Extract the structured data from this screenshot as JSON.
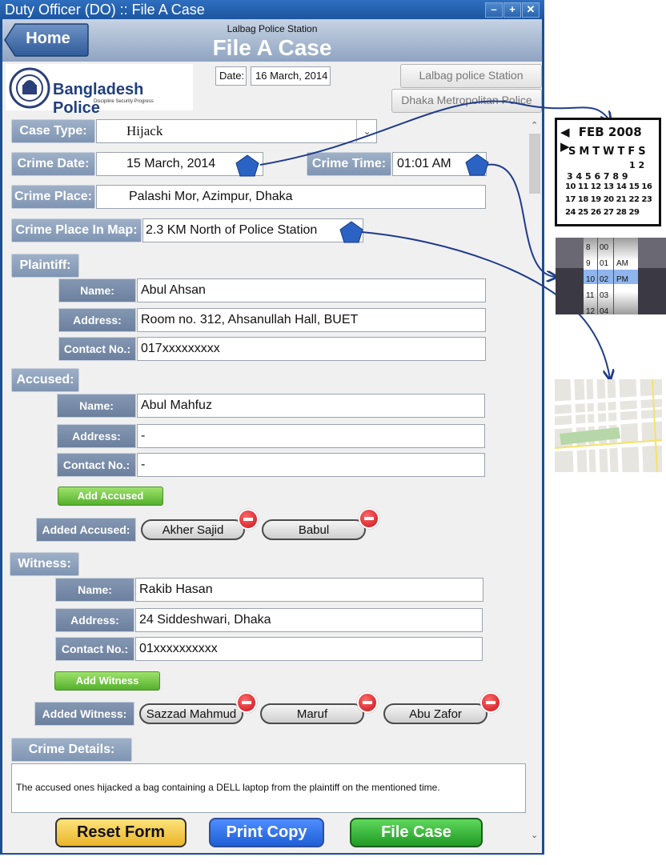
{
  "window": {
    "title": "Duty Officer (DO) :: File A Case",
    "buttons": [
      "minimize",
      "maximize",
      "close"
    ]
  },
  "header": {
    "home_label": "Home",
    "station": "Lalbag Police Station",
    "title": "File A Case"
  },
  "logo": {
    "name": "Bangladesh Police",
    "slogan": "Discipline Security Progress"
  },
  "date": {
    "label": "Date:",
    "value": "16 March, 2014"
  },
  "station_buttons": [
    "Lalbag police Station",
    "Dhaka Metropolitan Police"
  ],
  "case": {
    "case_type_label": "Case Type:",
    "case_type": "Hijack",
    "crime_date_label": "Crime Date:",
    "crime_date": "15 March, 2014",
    "crime_time_label": "Crime Time:",
    "crime_time": "01:01 AM",
    "crime_place_label": "Crime Place:",
    "crime_place": "Palashi Mor, Azimpur, Dhaka",
    "crime_map_label": "Crime Place In Map:",
    "crime_map": "2.3 KM North of Police Station"
  },
  "labels": {
    "name": "Name:",
    "address": "Address:",
    "contact": "Contact No.:"
  },
  "plaintiff": {
    "label": "Plaintiff:",
    "name": "Abul Ahsan",
    "address": "Room no. 312, Ahsanullah Hall, BUET",
    "contact": "017xxxxxxxxx"
  },
  "accused": {
    "label": "Accused:",
    "name": "Abul Mahfuz",
    "address": "-",
    "contact": "-",
    "add_button": "Add Accused",
    "added_label": "Added Accused:",
    "added": [
      "Akher Sajid",
      "Babul"
    ]
  },
  "witness": {
    "label": "Witness:",
    "name": "Rakib Hasan",
    "address": "24 Siddeshwari, Dhaka",
    "contact": "01xxxxxxxxxx",
    "add_button": "Add Witness",
    "added_label": "Added Witness:",
    "added": [
      "Sazzad Mahmud",
      "Maruf",
      "Abu Zafor"
    ]
  },
  "details": {
    "label": "Crime Details:",
    "text": "The accused ones hijacked a bag containing a DELL laptop from the plaintiff on the mentioned time."
  },
  "actions": {
    "reset": "Reset Form",
    "print": "Print Copy",
    "file": "File Case"
  },
  "calendar": {
    "month": "FEB 2008",
    "weekdays": "SMTWTFS",
    "rows": [
      "1 2",
      "3 4 5 6 7 8 9",
      "10 11 12 13 14 15 16",
      "17 18 19 20 21 22 23",
      "24 25 26 27 28 29"
    ]
  },
  "time_picker": {
    "hours": [
      "8",
      "9",
      "10",
      "11",
      "12"
    ],
    "minutes": [
      "00",
      "01",
      "02",
      "03",
      "04"
    ],
    "ampm": [
      "AM",
      "PM"
    ],
    "selected": "10 02 PM"
  },
  "colors": {
    "window_blue": "#1b4f92",
    "reset": "#f5c93a",
    "print": "#2f6fe0",
    "file": "#2fa832",
    "marker": "#2a63c4"
  }
}
